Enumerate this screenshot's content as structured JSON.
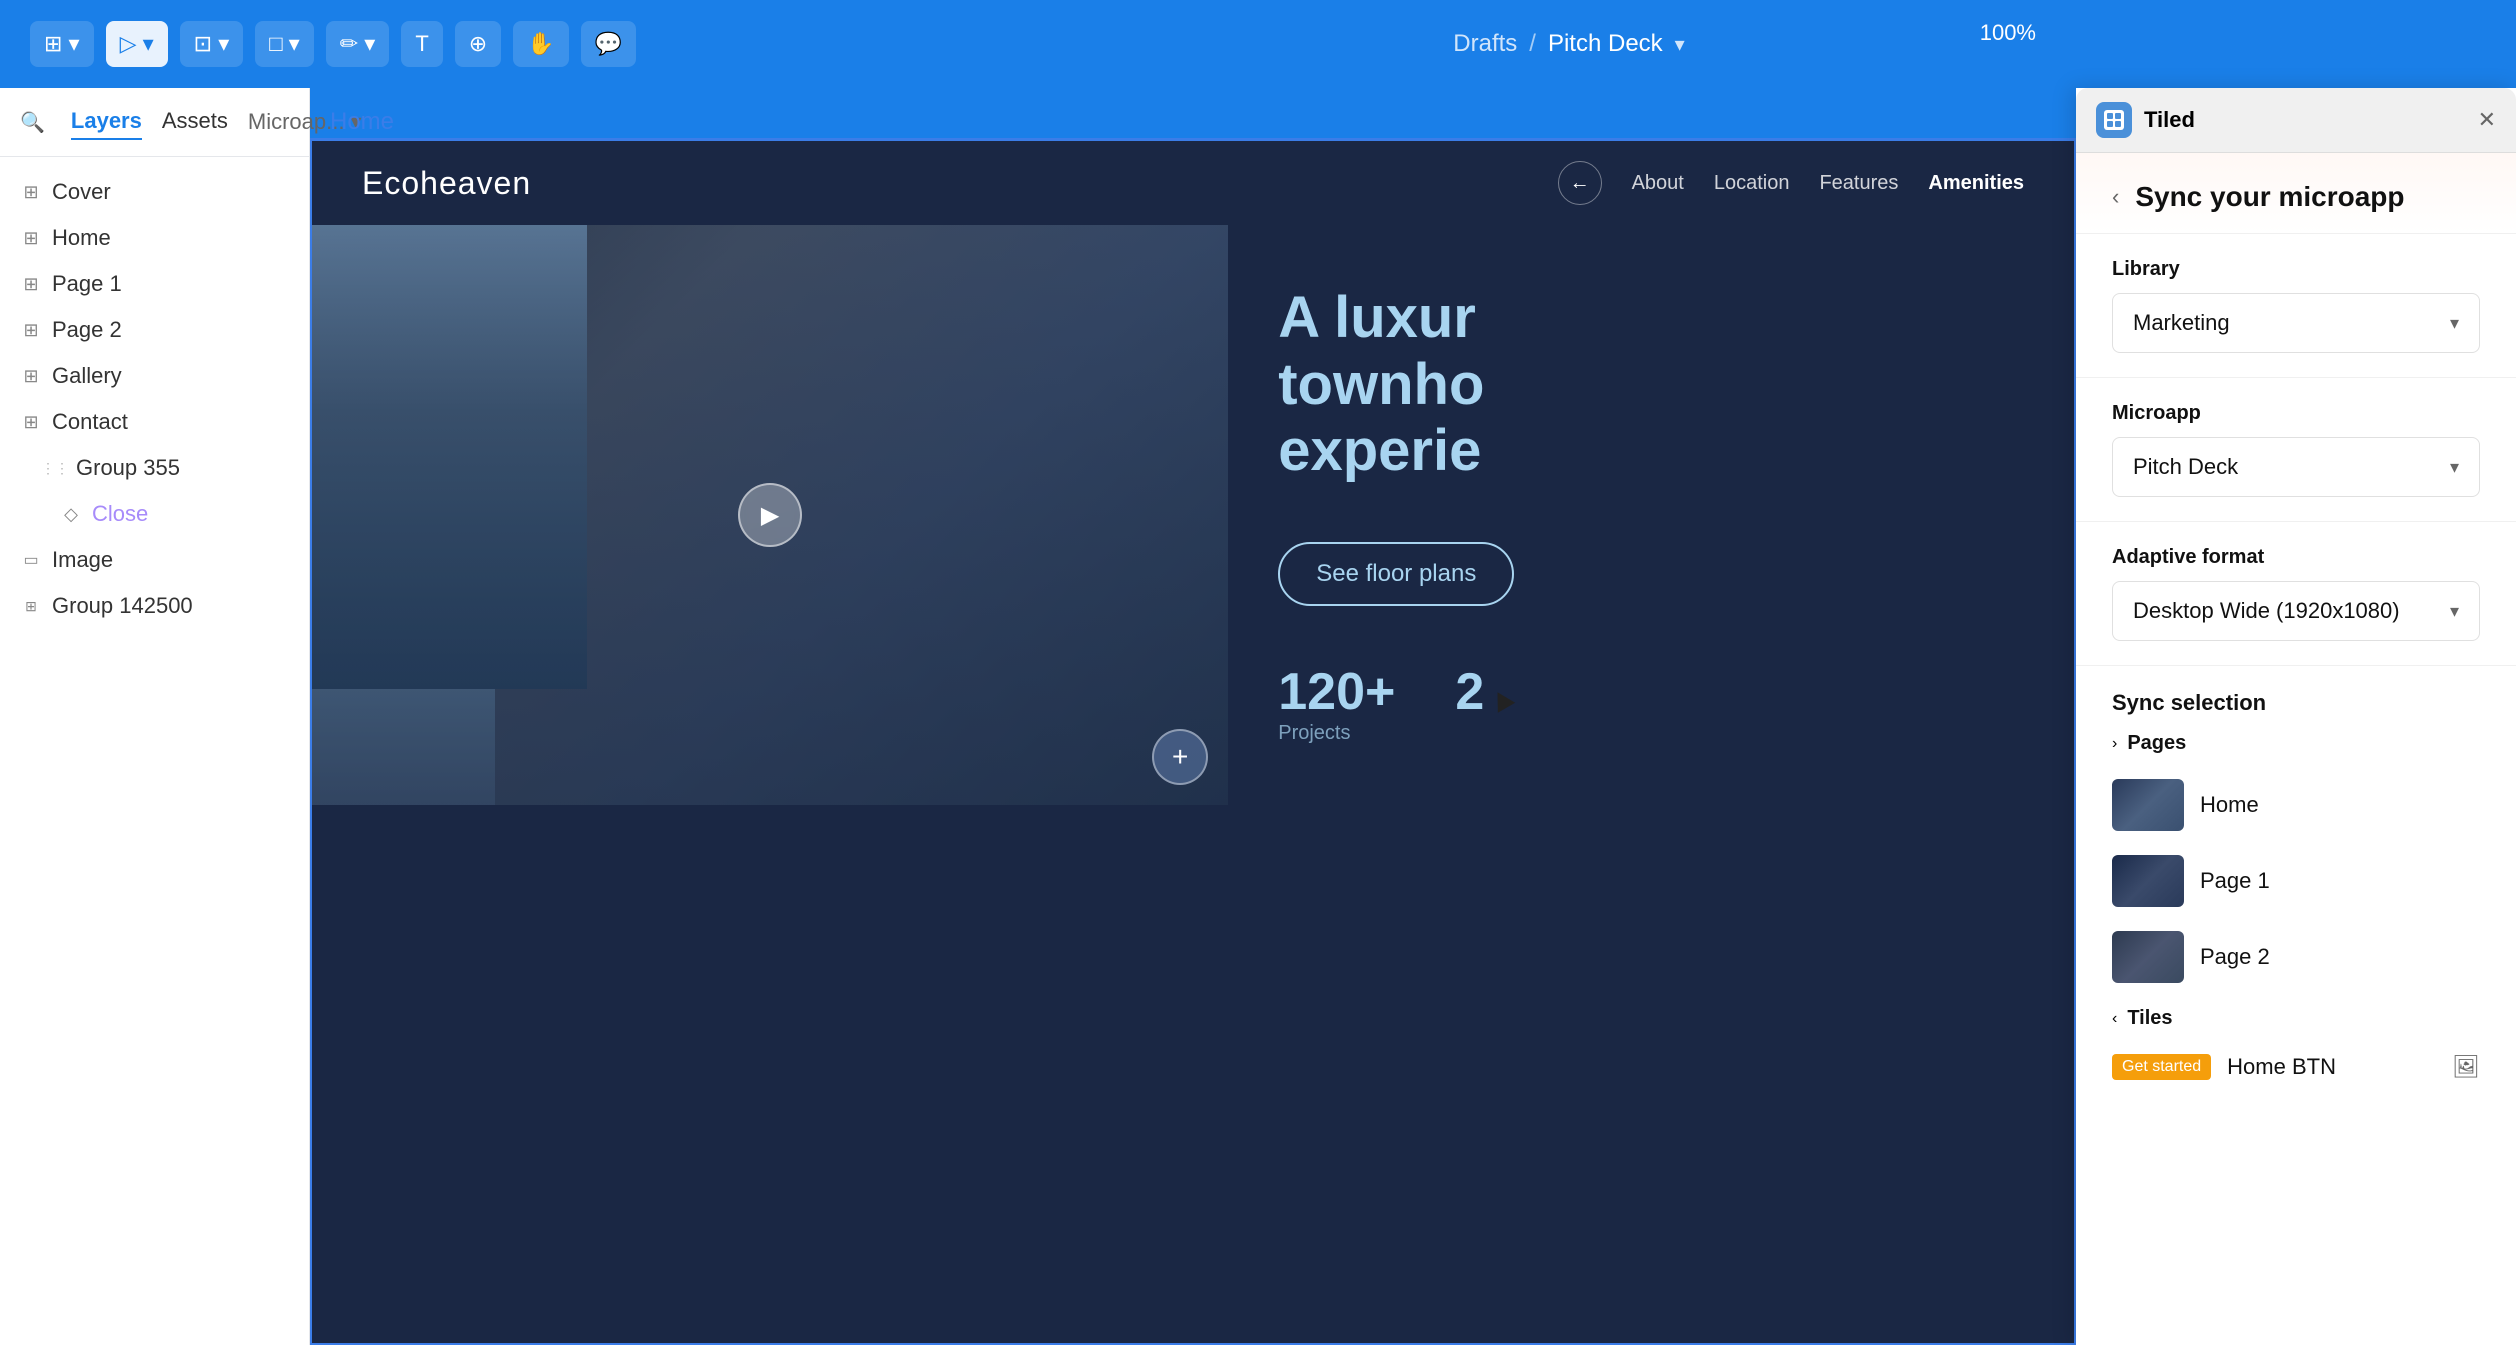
{
  "toolbar": {
    "breadcrumb_drafts": "Drafts",
    "breadcrumb_separator": "/",
    "breadcrumb_current": "Pitch Deck",
    "breadcrumb_arrow": "▾",
    "zoom": "100%"
  },
  "sidebar": {
    "tab_layers": "Layers",
    "tab_assets": "Assets",
    "tab_microapp": "Microap...",
    "tab_microapp_arrow": "▾",
    "layers": [
      {
        "icon": "grid",
        "label": "Cover"
      },
      {
        "icon": "grid",
        "label": "Home"
      },
      {
        "icon": "grid",
        "label": "Page 1"
      },
      {
        "icon": "grid",
        "label": "Page 2"
      },
      {
        "icon": "grid",
        "label": "Gallery"
      },
      {
        "icon": "grid",
        "label": "Contact"
      },
      {
        "icon": "grid-sub",
        "label": "Group 355",
        "indent": 1
      },
      {
        "icon": "diamond",
        "label": "Close",
        "indent": 2,
        "type": "close"
      },
      {
        "icon": "image",
        "label": "Image",
        "indent": 0
      },
      {
        "icon": "grid-small",
        "label": "Group 142500",
        "indent": 0
      }
    ]
  },
  "canvas": {
    "frame_label": "Home"
  },
  "website": {
    "logo": "Ecoheaven",
    "nav_links": [
      "About",
      "Location",
      "Features",
      "Amenities"
    ],
    "hero_title_line1": "A luxur",
    "hero_title_line2": "townho",
    "hero_title_line3": "experie",
    "cta_button": "See floor plans",
    "stat1_number": "120+",
    "stat1_label": "Projects",
    "stat2_number": "2",
    "stat2_label": ""
  },
  "panel": {
    "window_title": "Tiled",
    "title": "Sync your microapp",
    "library_label": "Library",
    "library_value": "Marketing",
    "microapp_label": "Microapp",
    "microapp_value": "Pitch Deck",
    "adaptive_format_label": "Adaptive format",
    "adaptive_format_value": "Desktop Wide (1920x1080)",
    "sync_selection_label": "Sync selection",
    "pages_label": "Pages",
    "pages_expand_icon": "›",
    "pages": [
      {
        "name": "Home",
        "thumb": "home"
      },
      {
        "name": "Page 1",
        "thumb": "page1"
      },
      {
        "name": "Page 2",
        "thumb": "page2"
      }
    ],
    "tiles_label": "Tiles",
    "tiles_collapse_icon": "‹",
    "tiles": [
      {
        "badge": "Get started",
        "name": "Home BTN",
        "has_image": true
      }
    ]
  }
}
